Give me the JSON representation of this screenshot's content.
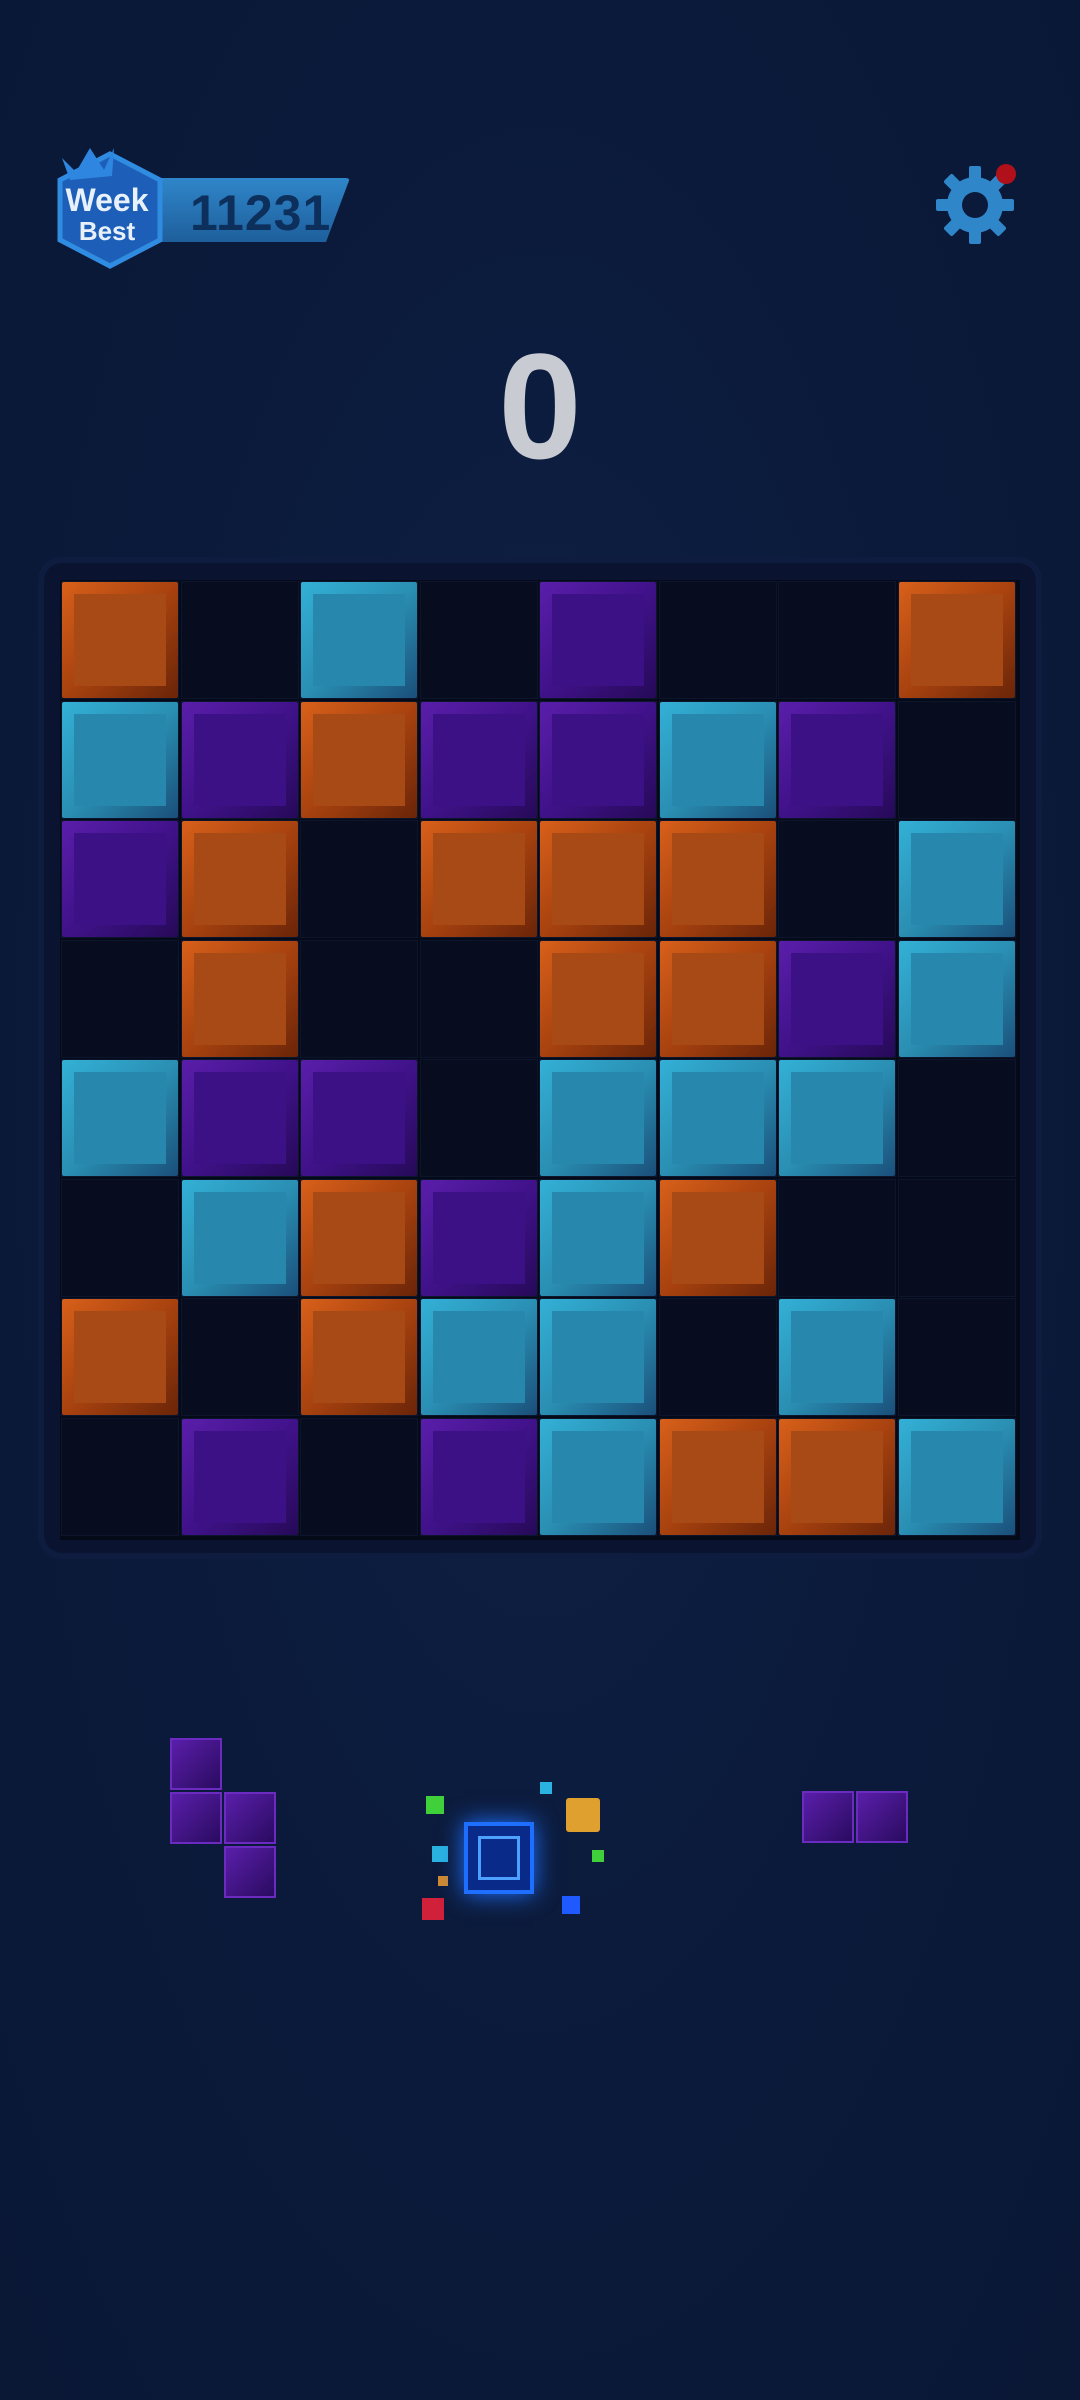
{
  "header": {
    "badge_week": "Week",
    "badge_best": "Best",
    "week_best_score": "11231",
    "settings_icon": "gear-icon",
    "settings_has_notification": true
  },
  "score": "0",
  "colors": {
    "background": "#0b1a3a",
    "orange": "#c2561a",
    "cyan": "#2a9ac2",
    "purple": "#40128a",
    "accent_blue": "#1e6fff"
  },
  "board": {
    "size": 8,
    "rows": [
      [
        "orange",
        null,
        "cyan",
        null,
        "purple",
        null,
        null,
        "orange"
      ],
      [
        "cyan",
        "purple",
        "orange",
        "purple",
        "purple",
        "cyan",
        "purple",
        null
      ],
      [
        "purple",
        "orange",
        null,
        "orange",
        "orange",
        "orange",
        null,
        "cyan"
      ],
      [
        null,
        "orange",
        null,
        null,
        "orange",
        "orange",
        "purple",
        "cyan"
      ],
      [
        "cyan",
        "purple",
        "purple",
        null,
        "cyan",
        "cyan",
        "cyan",
        null
      ],
      [
        null,
        "cyan",
        "orange",
        "purple",
        "cyan",
        "orange",
        null,
        null
      ],
      [
        "orange",
        null,
        "orange",
        "cyan",
        "cyan",
        null,
        "cyan",
        null
      ],
      [
        null,
        "purple",
        null,
        "purple",
        "cyan",
        "orange",
        "orange",
        "cyan"
      ]
    ]
  },
  "tray": {
    "pieces": [
      {
        "name": "purple-s-piece",
        "color": "purple",
        "cells": [
          [
            0,
            0
          ],
          [
            1,
            0
          ],
          [
            1,
            1
          ],
          [
            2,
            1
          ]
        ]
      },
      {
        "name": "single-blue-piece",
        "color": "blue",
        "cells": [
          [
            0,
            0
          ]
        ]
      },
      {
        "name": "purple-domino-piece",
        "color": "purple",
        "cells": [
          [
            0,
            0
          ],
          [
            0,
            1
          ]
        ]
      }
    ]
  }
}
